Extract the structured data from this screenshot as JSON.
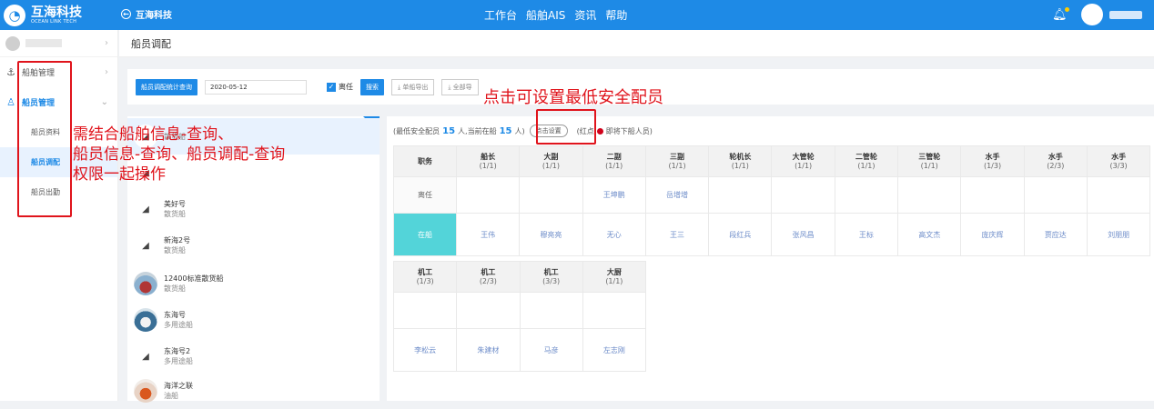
{
  "app": {
    "logo_mark": "◔",
    "logo_title": "互海科技",
    "logo_sub": "OCEAN LINK TECH",
    "back_label": "互海科技",
    "nav": [
      "工作台",
      "船舶AIS",
      "资讯",
      "帮助"
    ]
  },
  "sidebar": {
    "ship_mgmt": "船舶管理",
    "crew_mgmt": "船员管理",
    "sub": [
      "船员资料",
      "船员调配",
      "船员出勤"
    ]
  },
  "page": {
    "title": "船员调配"
  },
  "toolbar": {
    "stats_btn": "船员调配统计查询",
    "date": "2020-05-12",
    "leave_label": "离任",
    "search_btn": "搜索",
    "export_btn": "单船导出",
    "export_all_btn": "全部导"
  },
  "ships": [
    {
      "name": "",
      "type": "散货船"
    },
    {
      "name": "",
      "type": ""
    },
    {
      "name": "美好号",
      "type": "散货船"
    },
    {
      "name": "新海2号",
      "type": "散货船"
    },
    {
      "name": "12400标准散货船",
      "type": "散货船"
    },
    {
      "name": "东海号",
      "type": "多用途船"
    },
    {
      "name": "东海号2",
      "type": "多用途船"
    },
    {
      "name": "海洋之联",
      "type": "油船"
    }
  ],
  "summary": {
    "min_label": "(最低安全配员",
    "min_val": "15",
    "mid": "人,当前在船",
    "cur_val": "15",
    "end": "人)",
    "set_btn": "点击设置",
    "red_pre": "(红点",
    "red_post": "即将下船人员)"
  },
  "grid1": {
    "header": [
      [
        "职务",
        ""
      ],
      [
        "船长",
        "(1/1)"
      ],
      [
        "大副",
        "(1/1)"
      ],
      [
        "二副",
        "(1/1)"
      ],
      [
        "三副",
        "(1/1)"
      ],
      [
        "轮机长",
        "(1/1)"
      ],
      [
        "大管轮",
        "(1/1)"
      ],
      [
        "二管轮",
        "(1/1)"
      ],
      [
        "三管轮",
        "(1/1)"
      ],
      [
        "水手",
        "(1/3)"
      ],
      [
        "水手",
        "(2/3)"
      ],
      [
        "水手",
        "(3/3)"
      ]
    ],
    "leave_label": "离任",
    "leave": [
      "",
      "",
      "王坤鹏",
      "岳增增",
      "",
      "",
      "",
      "",
      "",
      "",
      ""
    ],
    "onboard_label": "在船",
    "onboard": [
      "王伟",
      "穆亮亮",
      "无心",
      "王三",
      "段红兵",
      "张风昌",
      "王标",
      "高文杰",
      "庞庆辉",
      "贾应达",
      "刘朋朋"
    ]
  },
  "grid2": {
    "header": [
      [
        "机工",
        "(1/3)"
      ],
      [
        "机工",
        "(2/3)"
      ],
      [
        "机工",
        "(3/3)"
      ],
      [
        "大厨",
        "(1/1)"
      ]
    ],
    "leave": [
      "",
      "",
      "",
      ""
    ],
    "onboard": [
      "李松云",
      "朱建材",
      "马彦",
      "左志刚"
    ]
  },
  "annotations": {
    "top": "点击可设置最低安全配员",
    "left": [
      "需结合船舶信息-查询、",
      "船员信息-查询、船员调配-查询",
      "权限一起操作"
    ]
  },
  "colors": {
    "primary": "#1e8ae6",
    "onboard": "#53d4d9",
    "annotation": "#e0141c"
  }
}
